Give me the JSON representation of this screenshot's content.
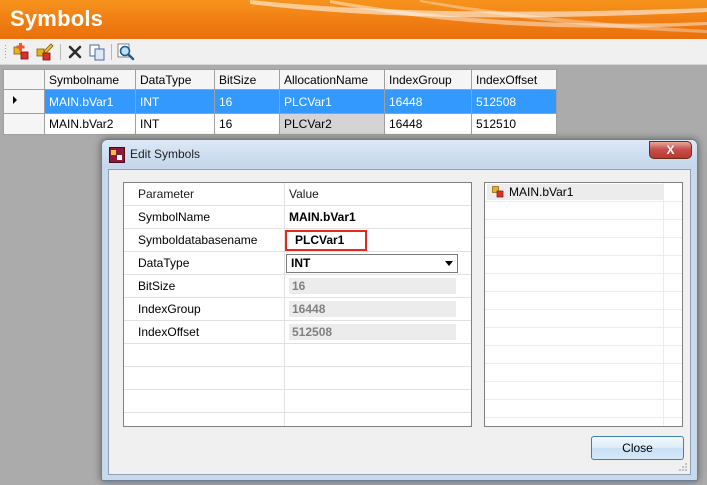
{
  "app": {
    "title": "Symbols"
  },
  "toolbar": {
    "buttons": [
      {
        "name": "add-symbol-icon"
      },
      {
        "name": "edit-symbol-icon"
      },
      {
        "name": "delete-icon"
      },
      {
        "name": "copy-icon"
      },
      {
        "name": "search-icon"
      }
    ]
  },
  "grid": {
    "columns": [
      "Symbolname",
      "DataType",
      "BitSize",
      "AllocationName",
      "IndexGroup",
      "IndexOffset"
    ],
    "rows": [
      {
        "symbolname": "MAIN.bVar1",
        "datatype": "INT",
        "bitsize": "16",
        "allocation": "PLCVar1",
        "indexgroup": "16448",
        "indexoffset": "512508",
        "selected": true
      },
      {
        "symbolname": "MAIN.bVar2",
        "datatype": "INT",
        "bitsize": "16",
        "allocation": "PLCVar2",
        "indexgroup": "16448",
        "indexoffset": "512510",
        "selected": false
      }
    ]
  },
  "dialog": {
    "title": "Edit Symbols",
    "close_glyph": "X",
    "property_header": {
      "parameter": "Parameter",
      "value": "Value"
    },
    "properties": {
      "symbolname": {
        "label": "SymbolName",
        "value": "MAIN.bVar1"
      },
      "symboldatabasename": {
        "label": "Symboldatabasename",
        "value": "PLCVar1"
      },
      "datatype": {
        "label": "DataType",
        "value": "INT"
      },
      "bitsize": {
        "label": "BitSize",
        "value": "16"
      },
      "indexgroup": {
        "label": "IndexGroup",
        "value": "16448"
      },
      "indexoffset": {
        "label": "IndexOffset",
        "value": "512508"
      }
    },
    "tree_item": "MAIN.bVar1",
    "close_button": "Close"
  },
  "colors": {
    "banner": "#f07d12",
    "selection": "#3399ff",
    "highlight_box": "#e8281d"
  }
}
